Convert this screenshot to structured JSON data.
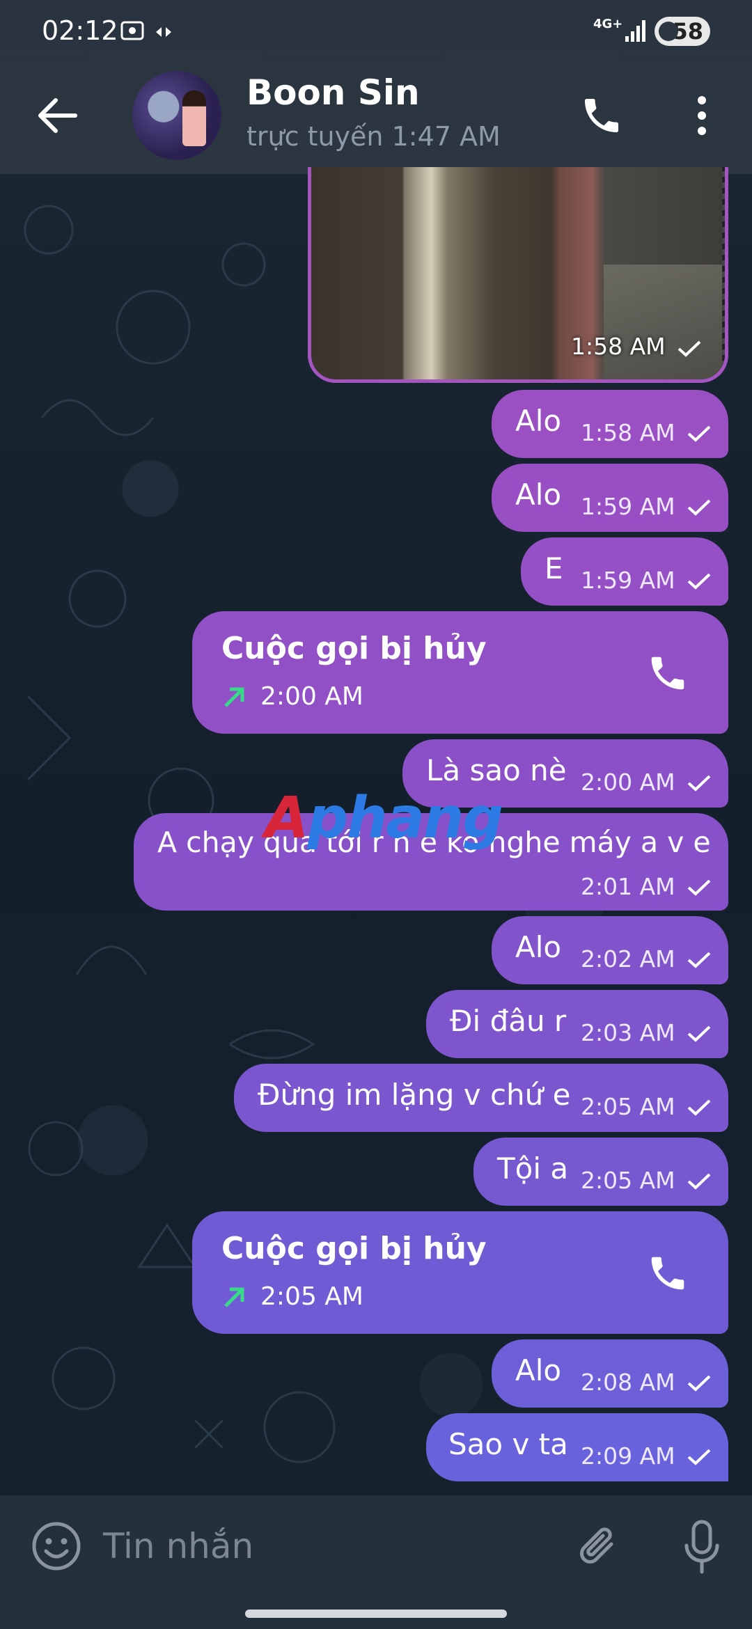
{
  "status_bar": {
    "time": "02:12",
    "network": "4G+",
    "battery": "58"
  },
  "header": {
    "name": "Boon Sin",
    "presence": "trực tuyến 1:47 AM"
  },
  "messages": [
    {
      "type": "photo",
      "time": "1:58 AM"
    },
    {
      "type": "text",
      "text": "Alo",
      "time": "1:58 AM"
    },
    {
      "type": "text",
      "text": "Alo",
      "time": "1:59 AM"
    },
    {
      "type": "text",
      "text": "E",
      "time": "1:59 AM"
    },
    {
      "type": "call",
      "text": "Cuộc gọi bị hủy",
      "time": "2:00 AM"
    },
    {
      "type": "text",
      "text": "Là sao nè",
      "time": "2:00 AM"
    },
    {
      "type": "text",
      "text": "A chạy qua tới r h e ko nghe máy a v e",
      "time": "2:01 AM"
    },
    {
      "type": "text",
      "text": "Alo",
      "time": "2:02 AM"
    },
    {
      "type": "text",
      "text": "Đi đâu r",
      "time": "2:03 AM"
    },
    {
      "type": "text",
      "text": "Đừng im lặng v chứ e",
      "time": "2:05 AM"
    },
    {
      "type": "text",
      "text": "Tội a",
      "time": "2:05 AM"
    },
    {
      "type": "call",
      "text": "Cuộc gọi bị hủy",
      "time": "2:05 AM"
    },
    {
      "type": "text",
      "text": "Alo",
      "time": "2:08 AM"
    },
    {
      "type": "text",
      "text": "Sao v ta",
      "time": "2:09 AM"
    }
  ],
  "watermark": {
    "part1": "A",
    "part2": "phang"
  },
  "input": {
    "placeholder": "Tin nhắn"
  },
  "colors": {
    "bubble_top": "#9d4fc4",
    "bubble_bottom": "#6a66e4",
    "header_bg": "#2c3641",
    "call_arrow": "#39d98a"
  }
}
